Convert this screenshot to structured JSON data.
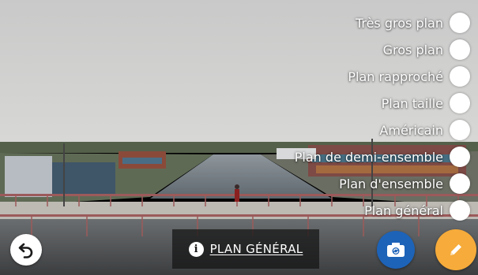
{
  "colors": {
    "camera_button": "#1d63b8",
    "edit_button": "#f6ab3a",
    "radio_fill": "#ffffff",
    "info_bar_bg": "#141414"
  },
  "shot_options": [
    {
      "label": "Très gros plan"
    },
    {
      "label": "Gros plan"
    },
    {
      "label": "Plan rapproché"
    },
    {
      "label": "Plan taille"
    },
    {
      "label": "Américain"
    },
    {
      "label": "Plan de demi-ensemble"
    },
    {
      "label": "Plan d'ensemble"
    },
    {
      "label": "Plan général"
    }
  ],
  "bottom_bar": {
    "undo_icon": "undo-arrow-icon",
    "info_icon_glyph": "i",
    "info_label": "PLAN GÉNÉRAL",
    "camera_icon": "camera-switch-icon",
    "edit_icon": "pencil-icon"
  }
}
